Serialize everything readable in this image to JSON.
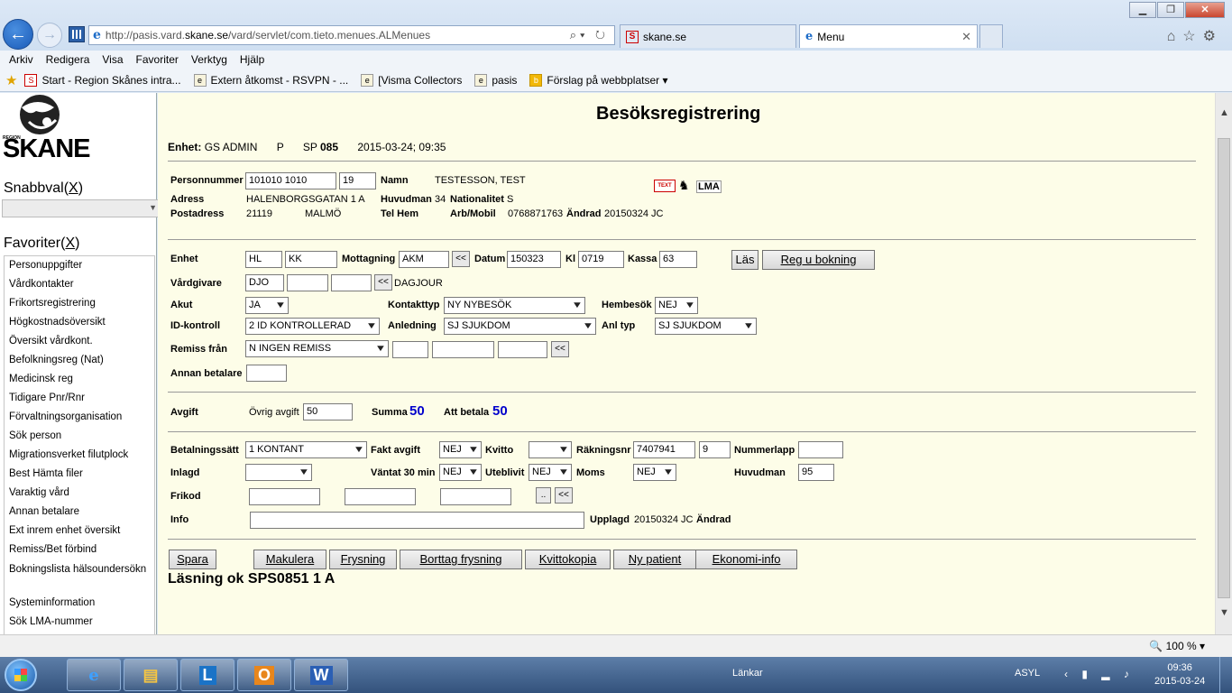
{
  "browser": {
    "url_prefix": "http://pasis.vard.",
    "url_domain": "skane.se",
    "url_suffix": "/vard/servlet/com.tieto.menues.ALMenues",
    "tabs": [
      {
        "label": "skane.se",
        "icon": "skane-favicon"
      },
      {
        "label": "Menu",
        "icon": "ie-favicon"
      }
    ],
    "menu": [
      "Arkiv",
      "Redigera",
      "Visa",
      "Favoriter",
      "Verktyg",
      "Hjälp"
    ],
    "favorites_bar": [
      "Start - Region Skånes intra...",
      "Extern åtkomst - RSVPN - ...",
      "[Visma Collectors",
      "pasis",
      "Förslag på webbplatser ▾"
    ],
    "zoom": "100 %"
  },
  "sidebar": {
    "logo_region": "REGION",
    "logo_name": "SKANE",
    "snabbval_title": "Snabbval(",
    "snabbval_x": "X",
    "snabbval_close": ")",
    "favoriter_title": "Favoriter(",
    "favoriter_x": "X",
    "favoriter_close": ")",
    "items": [
      "Personuppgifter",
      "Vårdkontakter",
      "Frikortsregistrering",
      "Högkostnadsöversikt",
      "Översikt vårdkont.",
      "Befolkningsreg (Nat)",
      "Medicinsk reg",
      "Tidigare Pnr/Rnr",
      "Förvaltningsorganisation",
      "Sök person",
      "Migrationsverket filutplock",
      "Best Hämta filer",
      "Varaktig vård",
      "Annan betalare",
      "Ext inrem enhet översikt",
      "Remiss/Bet förbind",
      "Bokningslista hälsoundersökn",
      "Systeminformation",
      "Sök LMA-nummer"
    ]
  },
  "page": {
    "title": "Besöksregistrering",
    "enhet_label": "Enhet:",
    "enhet_value": "GS ADMIN",
    "p": "P",
    "sp_label": "SP",
    "sp_value": "085",
    "datetime": "2015-03-24; 09:35"
  },
  "patient": {
    "pnr_label": "Personnummer",
    "pnr_value": "101010 1010",
    "pnr_check": "19",
    "namn_label": "Namn",
    "namn_value": "TESTESSON, TEST",
    "adress_label": "Adress",
    "adress_value": "HALENBORGSGATAN 1 A",
    "huvudman_label": "Huvudman",
    "huvudman_value": "34",
    "nationalitet_label": "Nationalitet",
    "nationalitet_value": "S",
    "postadress_label": "Postadress",
    "postnr": "21119",
    "ort": "MALMÖ",
    "telhem_label": "Tel Hem",
    "arbmobil_label": "Arb/Mobil",
    "arbmobil_value": "0768871763",
    "andrad_label": "Ändrad",
    "andrad_value": "20150324 JC",
    "text_icon": "TEXT",
    "lma_label": "LMA"
  },
  "visit": {
    "enhet_label": "Enhet",
    "enhet_1": "HL",
    "enhet_2": "KK",
    "mottagning_label": "Mottagning",
    "mottagning_value": "AKM",
    "datum_label": "Datum",
    "datum_value": "150323",
    "kl_label": "Kl",
    "kl_value": "0719",
    "kassa_label": "Kassa",
    "kassa_value": "63",
    "las_button": "Läs",
    "reg_bokning_button": "Reg u bokning",
    "vardgivare_label": "Vårdgivare",
    "vardgivare_value": "DJO",
    "vardgivare_name": "DAGJOUR",
    "akut_label": "Akut",
    "akut_value": "JA",
    "kontakttyp_label": "Kontakttyp",
    "kontakttyp_value": "NY NYBESÖK",
    "hembesok_label": "Hembesök",
    "hembesok_value": "NEJ",
    "idkontroll_label": "ID-kontroll",
    "idkontroll_value": "2 ID KONTROLLERAD",
    "anledning_label": "Anledning",
    "anledning_value": "SJ SJUKDOM",
    "anltyp_label": "Anl typ",
    "anltyp_value": "SJ SJUKDOM",
    "remiss_label": "Remiss från",
    "remiss_value": "N INGEN REMISS",
    "annan_betalare_label": "Annan betalare",
    "back_btn": "<<"
  },
  "fee": {
    "avgift_label": "Avgift",
    "ovrig_label": "Övrig avgift",
    "ovrig_value": "50",
    "summa_label": "Summa",
    "summa_value": "50",
    "att_betala_label": "Att betala",
    "att_betala_value": "50"
  },
  "payment": {
    "betalningssatt_label": "Betalningssätt",
    "betalningssatt_value": "1 KONTANT",
    "fakt_avgift_label": "Fakt avgift",
    "fakt_avgift_value": "NEJ",
    "kvitto_label": "Kvitto",
    "kvitto_value": "",
    "rakningsnr_label": "Räkningsnr",
    "rakningsnr_value": "7407941",
    "rakningsnr_check": "9",
    "nummerlapp_label": "Nummerlapp",
    "inlagd_label": "Inlagd",
    "vantat_label": "Väntat 30 min",
    "vantat_value": "NEJ",
    "uteblivit_label": "Uteblivit",
    "uteblivit_value": "NEJ",
    "moms_label": "Moms",
    "moms_value": "NEJ",
    "huvudman_label": "Huvudman",
    "huvudman_value": "95",
    "frikod_label": "Frikod",
    "dots_btn": "..",
    "info_label": "Info",
    "upplagd_label": "Upplagd",
    "upplagd_value": "20150324 JC",
    "andrad_label": "Ändrad"
  },
  "actions": {
    "spara": "Spara",
    "makulera": "Makulera",
    "frysning": "Frysning",
    "borttag_frysning": "Borttag frysning",
    "kvittokopia": "Kvittokopia",
    "ny_patient": "Ny patient",
    "ekonomi_info": "Ekonomi-info"
  },
  "status_message": "Läsning ok SPS0851 1 A",
  "taskbar": {
    "links": "Länkar",
    "asyl": "ASYL",
    "time": "09:36",
    "date": "2015-03-24"
  }
}
